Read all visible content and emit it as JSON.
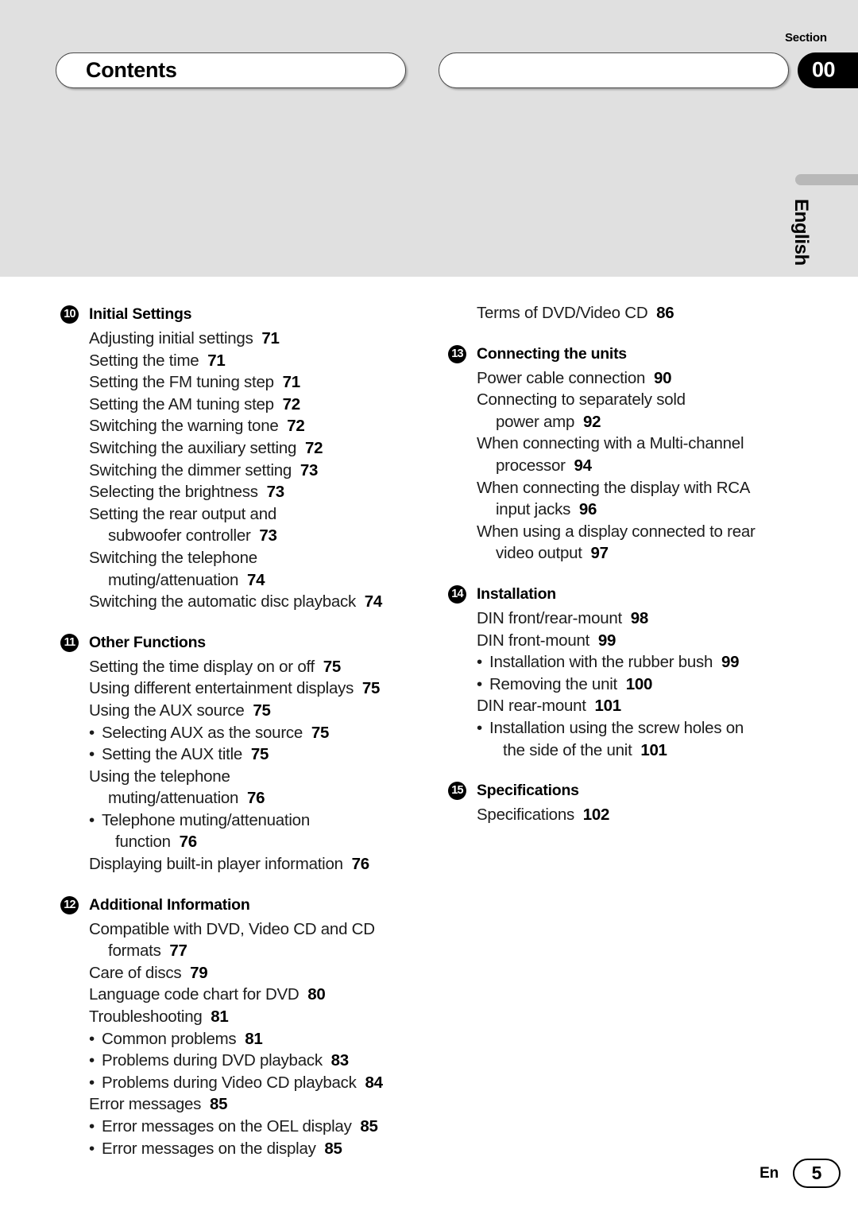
{
  "header": {
    "section_label": "Section",
    "title": "Contents",
    "subtitle": "",
    "section_number": "00",
    "language_tab": "English"
  },
  "footer": {
    "language_code": "En",
    "page_number": "5"
  },
  "columns": {
    "left": [
      {
        "badge": "10",
        "heading": "Initial Settings",
        "entries": [
          {
            "type": "line",
            "text": "Adjusting initial settings",
            "page": "71"
          },
          {
            "type": "line",
            "text": "Setting the time",
            "page": "71"
          },
          {
            "type": "line",
            "text": "Setting the FM tuning step",
            "page": "71"
          },
          {
            "type": "line",
            "text": "Setting the AM tuning step",
            "page": "72"
          },
          {
            "type": "line",
            "text": "Switching the warning tone",
            "page": "72"
          },
          {
            "type": "line",
            "text": "Switching the auxiliary setting",
            "page": "72"
          },
          {
            "type": "line",
            "text": "Switching the dimmer setting",
            "page": "73"
          },
          {
            "type": "line",
            "text": "Selecting the brightness",
            "page": "73"
          },
          {
            "type": "line",
            "text": "Setting the rear output and",
            "page": ""
          },
          {
            "type": "cont",
            "text": "subwoofer controller",
            "page": "73"
          },
          {
            "type": "line",
            "text": "Switching the telephone",
            "page": ""
          },
          {
            "type": "cont",
            "text": "muting/attenuation",
            "page": "74"
          },
          {
            "type": "line",
            "text": "Switching the automatic disc playback",
            "page": "74"
          }
        ]
      },
      {
        "badge": "11",
        "heading": "Other Functions",
        "entries": [
          {
            "type": "line",
            "text": "Setting the time display on or off",
            "page": "75"
          },
          {
            "type": "line",
            "text": "Using different entertainment displays",
            "page": "75"
          },
          {
            "type": "line",
            "text": "Using the AUX source",
            "page": "75"
          },
          {
            "type": "bullet",
            "text": "Selecting AUX as the source",
            "page": "75"
          },
          {
            "type": "bullet",
            "text": "Setting the AUX title",
            "page": "75"
          },
          {
            "type": "line",
            "text": "Using the telephone",
            "page": ""
          },
          {
            "type": "cont",
            "text": "muting/attenuation",
            "page": "76"
          },
          {
            "type": "bullet",
            "text": "Telephone muting/attenuation",
            "page": ""
          },
          {
            "type": "bullet-cont",
            "text": "function",
            "page": "76"
          },
          {
            "type": "line",
            "text": "Displaying built-in player information",
            "page": "76"
          }
        ]
      },
      {
        "badge": "12",
        "heading": "Additional Information",
        "entries": [
          {
            "type": "line",
            "text": "Compatible with DVD, Video CD and CD",
            "page": ""
          },
          {
            "type": "cont",
            "text": "formats",
            "page": "77"
          },
          {
            "type": "line",
            "text": "Care of discs",
            "page": "79"
          },
          {
            "type": "line",
            "text": "Language code chart for DVD",
            "page": "80"
          },
          {
            "type": "line",
            "text": "Troubleshooting",
            "page": "81"
          },
          {
            "type": "bullet",
            "text": "Common problems",
            "page": "81"
          },
          {
            "type": "bullet",
            "text": "Problems during DVD playback",
            "page": "83"
          },
          {
            "type": "bullet",
            "text": "Problems during Video CD playback",
            "page": "84"
          },
          {
            "type": "line",
            "text": "Error messages",
            "page": "85"
          },
          {
            "type": "bullet",
            "text": "Error messages on the OEL display",
            "page": "85"
          },
          {
            "type": "bullet",
            "text": "Error messages on the display",
            "page": "85"
          }
        ]
      }
    ],
    "right": [
      {
        "badge": "",
        "heading": "",
        "entries": [
          {
            "type": "line",
            "text": "Terms of DVD/Video CD",
            "page": "86"
          }
        ]
      },
      {
        "badge": "13",
        "heading": "Connecting the units",
        "entries": [
          {
            "type": "line",
            "text": "Power cable connection",
            "page": "90"
          },
          {
            "type": "line",
            "text": "Connecting to separately sold",
            "page": ""
          },
          {
            "type": "cont",
            "text": "power amp",
            "page": "92"
          },
          {
            "type": "line",
            "text": "When connecting with a Multi-channel",
            "page": ""
          },
          {
            "type": "cont",
            "text": "processor",
            "page": "94"
          },
          {
            "type": "line",
            "text": "When connecting the display with RCA",
            "page": ""
          },
          {
            "type": "cont",
            "text": "input jacks",
            "page": "96"
          },
          {
            "type": "line",
            "text": "When using a display connected to rear",
            "page": ""
          },
          {
            "type": "cont",
            "text": "video output",
            "page": "97"
          }
        ]
      },
      {
        "badge": "14",
        "heading": "Installation",
        "entries": [
          {
            "type": "line",
            "text": "DIN front/rear-mount",
            "page": "98"
          },
          {
            "type": "line",
            "text": "DIN front-mount",
            "page": "99"
          },
          {
            "type": "bullet",
            "text": "Installation with the rubber bush",
            "page": "99"
          },
          {
            "type": "bullet",
            "text": "Removing the unit",
            "page": "100"
          },
          {
            "type": "line",
            "text": "DIN rear-mount",
            "page": "101"
          },
          {
            "type": "bullet",
            "text": "Installation using the screw holes on",
            "page": ""
          },
          {
            "type": "bullet-cont",
            "text": "the side of the unit",
            "page": "101"
          }
        ]
      },
      {
        "badge": "15",
        "heading": "Specifications",
        "entries": [
          {
            "type": "line",
            "text": "Specifications",
            "page": "102"
          }
        ]
      }
    ]
  }
}
